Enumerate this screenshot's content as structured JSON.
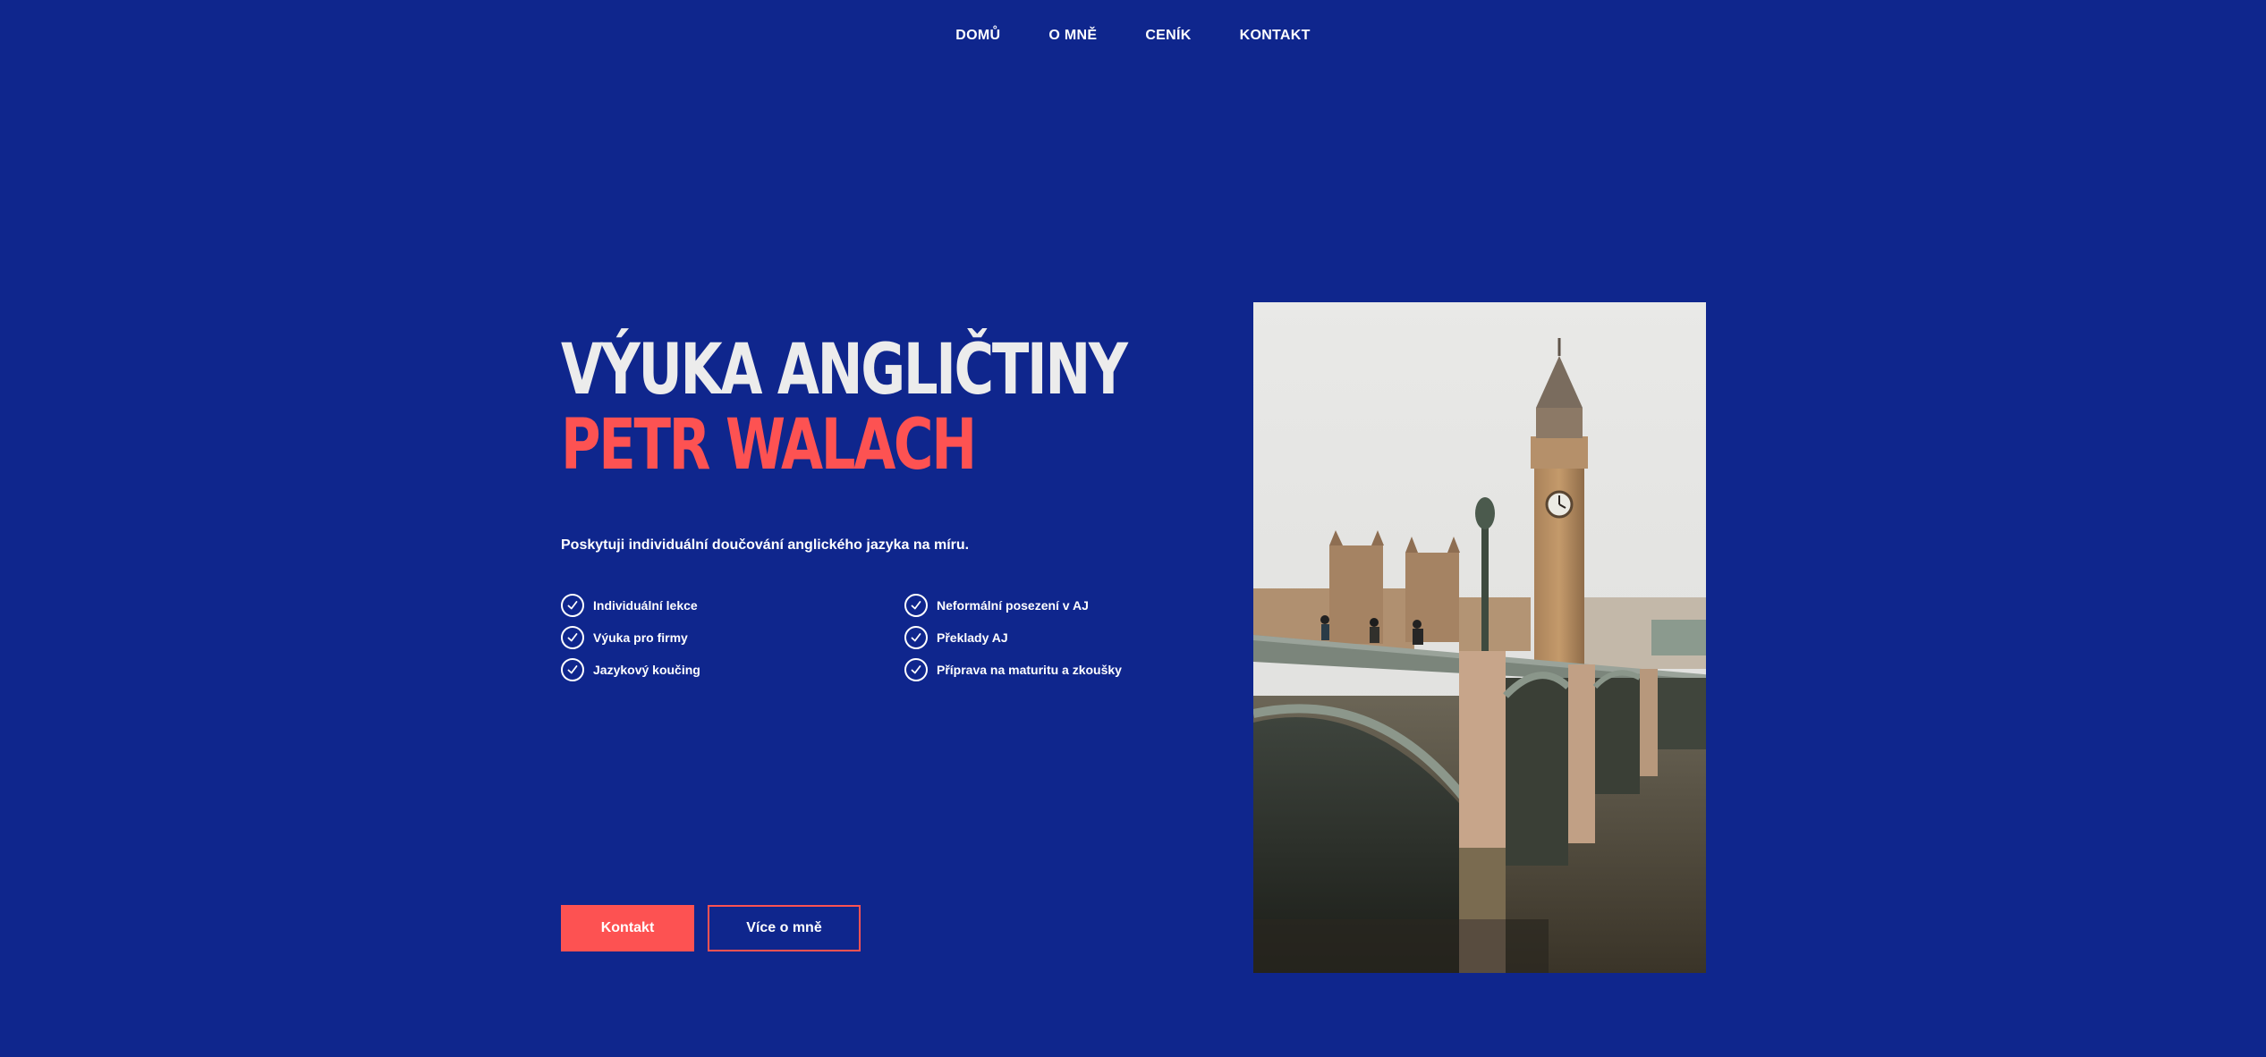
{
  "nav": {
    "items": [
      {
        "label": "DOMŮ"
      },
      {
        "label": "O MNĚ"
      },
      {
        "label": "CENÍK"
      },
      {
        "label": "KONTAKT"
      }
    ]
  },
  "hero": {
    "title_line1": "VÝUKA ANGLIČTINY",
    "title_line2": "PETR WALACH",
    "intro": "Poskytuji individuální doučování anglického jazyka na míru.",
    "features": [
      {
        "label": "Individuální lekce"
      },
      {
        "label": "Neformální posezení v AJ"
      },
      {
        "label": "Výuka pro firmy"
      },
      {
        "label": "Překlady AJ"
      },
      {
        "label": "Jazykový koučing"
      },
      {
        "label": "Příprava na maturitu a zkoušky"
      }
    ],
    "feature_icon": "check-circle-icon"
  },
  "buttons": {
    "primary_label": "Kontakt",
    "secondary_label": "Více o mně"
  },
  "photo": {
    "subject": "big-ben-westminster-bridge-photo"
  },
  "colors": {
    "background": "#0f268d",
    "accent": "#fd5252",
    "title_light": "#ececec",
    "text": "#ffffff"
  }
}
